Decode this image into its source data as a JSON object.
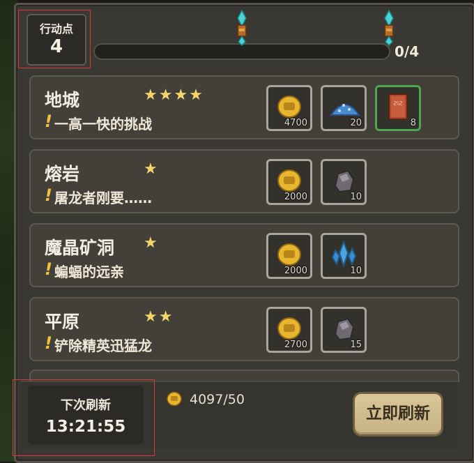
{
  "action_points": {
    "title": "行动点",
    "value": "4"
  },
  "progress": {
    "text": "0/4",
    "current": 0,
    "max": 4
  },
  "dungeons": [
    {
      "name": "地城",
      "stars": "★★★★",
      "subtitle": "一高一快的挑战",
      "excl": "!",
      "rewards": [
        {
          "icon": "gold-coin-icon",
          "qty": "4700"
        },
        {
          "icon": "blue-powder-icon",
          "qty": "20"
        },
        {
          "icon": "spellbook-icon",
          "qty": "8",
          "highlight": true
        }
      ]
    },
    {
      "name": "熔岩",
      "stars": "★",
      "subtitle": "屠龙者刚要……",
      "excl": "!",
      "rewards": [
        {
          "icon": "gold-coin-icon",
          "qty": "2000"
        },
        {
          "icon": "ore-rock-icon",
          "qty": "10"
        }
      ]
    },
    {
      "name": "魔晶矿洞",
      "stars": "★",
      "subtitle": "蝙蝠的远亲",
      "excl": "!",
      "rewards": [
        {
          "icon": "gold-coin-icon",
          "qty": "2000"
        },
        {
          "icon": "blue-crystal-icon",
          "qty": "10"
        }
      ]
    },
    {
      "name": "平原",
      "stars": "★★",
      "subtitle": "铲除精英迅猛龙",
      "excl": "!",
      "rewards": [
        {
          "icon": "gold-coin-icon",
          "qty": "2700"
        },
        {
          "icon": "ore-rock-icon",
          "qty": "15"
        }
      ]
    }
  ],
  "refresh": {
    "label": "下次刷新",
    "time": "13:21:55"
  },
  "gold": {
    "count": "4097/50",
    "icon": "gold-coin-icon"
  },
  "refresh_button": {
    "label": "立即刷新"
  },
  "colors": {
    "star": "#f3d56a",
    "exclamation": "#f2c23a",
    "highlight_border": "#4ea650"
  }
}
